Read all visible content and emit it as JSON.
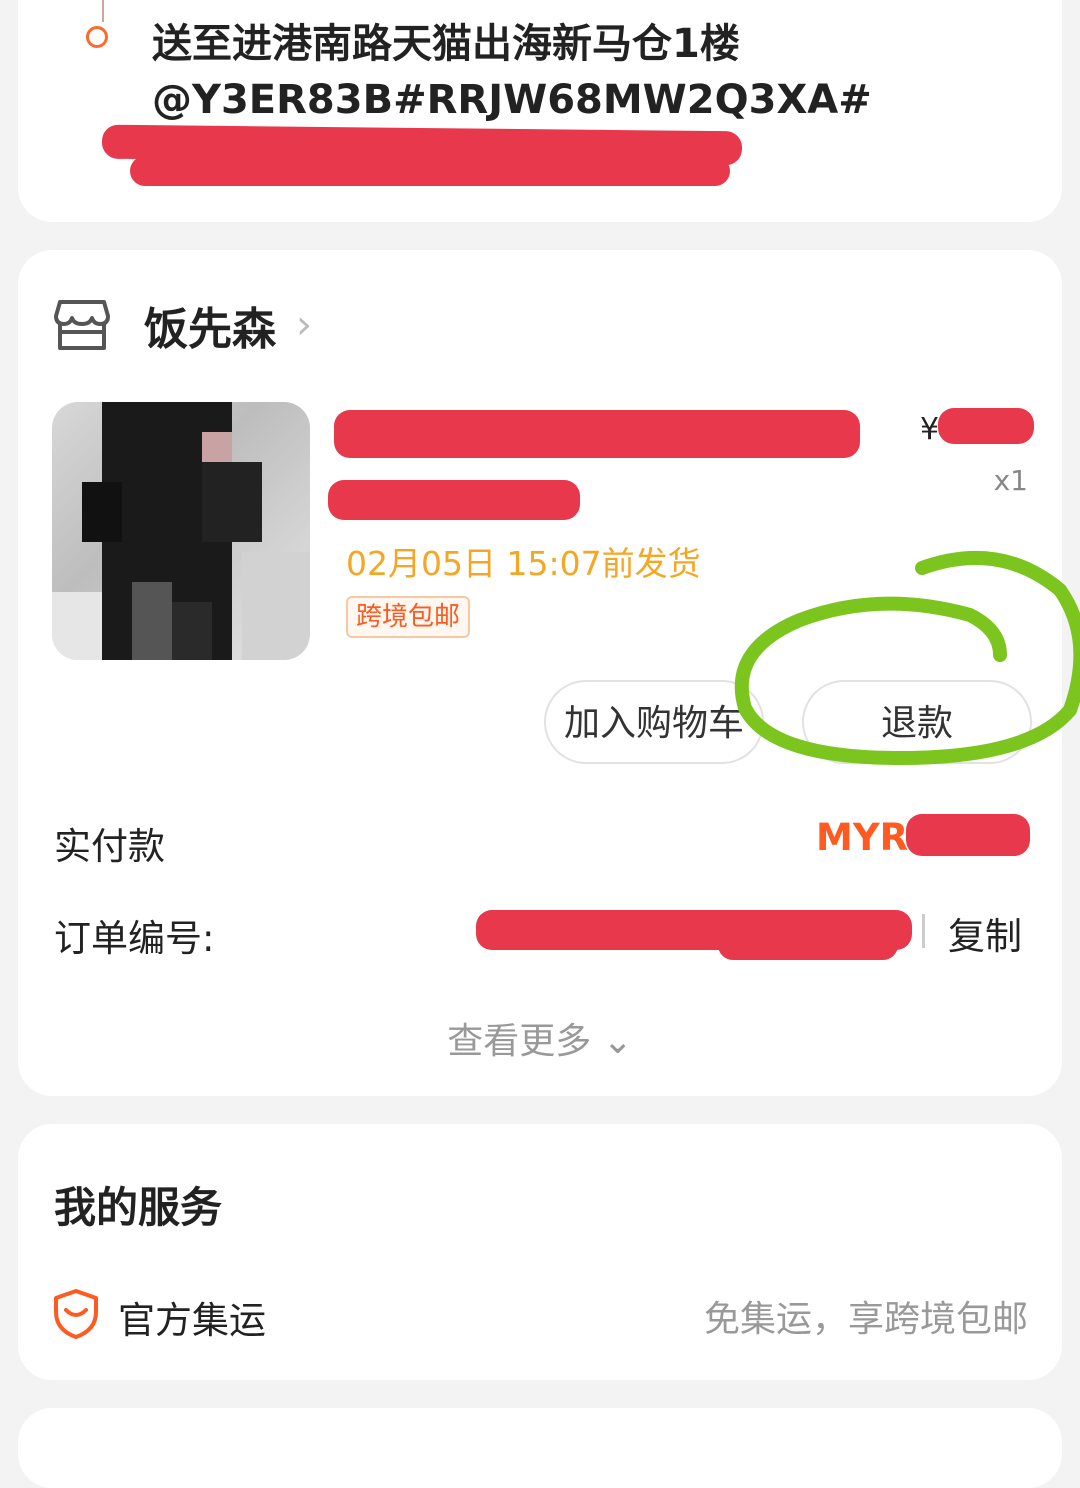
{
  "address": {
    "line1": "送至进港南路天猫出海新马仓1楼",
    "line2": "@Y3ER83B#RRJW68MW2Q3XA#"
  },
  "shop": {
    "name": "饭先森",
    "chevron": "›"
  },
  "product": {
    "price_symbol": "¥",
    "quantity": "x1",
    "ship_time": "02月05日 15:07前发货",
    "tag": "跨境包邮"
  },
  "actions": {
    "add_to_cart": "加入购物车",
    "refund": "退款"
  },
  "order": {
    "paid_label": "实付款",
    "paid_currency": "MYR",
    "order_no_label": "订单编号:",
    "copy_label": "复制",
    "see_more": "查看更多 ⌄"
  },
  "services": {
    "title": "我的服务",
    "item_name": "官方集运",
    "item_desc": "免集运，享跨境包邮"
  },
  "colors": {
    "accent": "#ff5a1f",
    "ship_time": "#f5a623",
    "redaction": "#e8384b",
    "annotation": "#7cc51f"
  }
}
